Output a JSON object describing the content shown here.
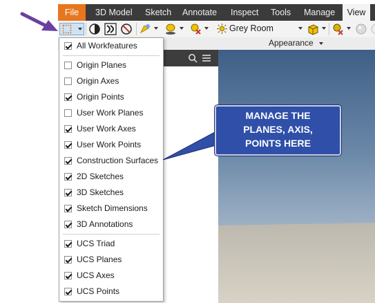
{
  "ribbon": {
    "tabs": [
      {
        "label": "File"
      },
      {
        "label": "3D Model"
      },
      {
        "label": "Sketch"
      },
      {
        "label": "Annotate"
      },
      {
        "label": "Inspect"
      },
      {
        "label": "Tools"
      },
      {
        "label": "Manage"
      },
      {
        "label": "View"
      }
    ],
    "active_tab": "View"
  },
  "toolbar": {
    "visual_style": "Grey Room",
    "panel_label": "Appearance"
  },
  "menu": {
    "items": [
      {
        "label": "All Workfeatures",
        "checked": true
      },
      {
        "label": "Origin Planes",
        "checked": false
      },
      {
        "label": "Origin Axes",
        "checked": false
      },
      {
        "label": "Origin Points",
        "checked": true
      },
      {
        "label": "User Work Planes",
        "checked": false
      },
      {
        "label": "User Work Axes",
        "checked": true
      },
      {
        "label": "User Work Points",
        "checked": true
      },
      {
        "label": "Construction Surfaces",
        "checked": true
      },
      {
        "label": "2D Sketches",
        "checked": true
      },
      {
        "label": "3D Sketches",
        "checked": true
      },
      {
        "label": "Sketch Dimensions",
        "checked": true
      },
      {
        "label": "3D Annotations",
        "checked": true
      },
      {
        "label": "UCS Triad",
        "checked": true
      },
      {
        "label": "UCS Planes",
        "checked": true
      },
      {
        "label": "UCS Axes",
        "checked": true
      },
      {
        "label": "UCS Points",
        "checked": true
      }
    ]
  },
  "callout": {
    "lines": [
      "MANAGE THE",
      "PLANES, AXIS,",
      "POINTS HERE"
    ]
  },
  "colors": {
    "file_tab": "#e8761e",
    "ribbon_dark": "#3b3b3b",
    "callout_fill": "#2f4fa8",
    "arrow": "#6b3fa0"
  },
  "icons": [
    "object-visibility-icon",
    "visual-style-icon",
    "shadow-icon",
    "reflections-icon",
    "lighting-icon",
    "ground-shadow-icon",
    "material-icon",
    "appearance-sphere-icon",
    "color-override-icon",
    "sphere-icon",
    "chevron-down-icon",
    "search-icon",
    "menu-icon"
  ]
}
